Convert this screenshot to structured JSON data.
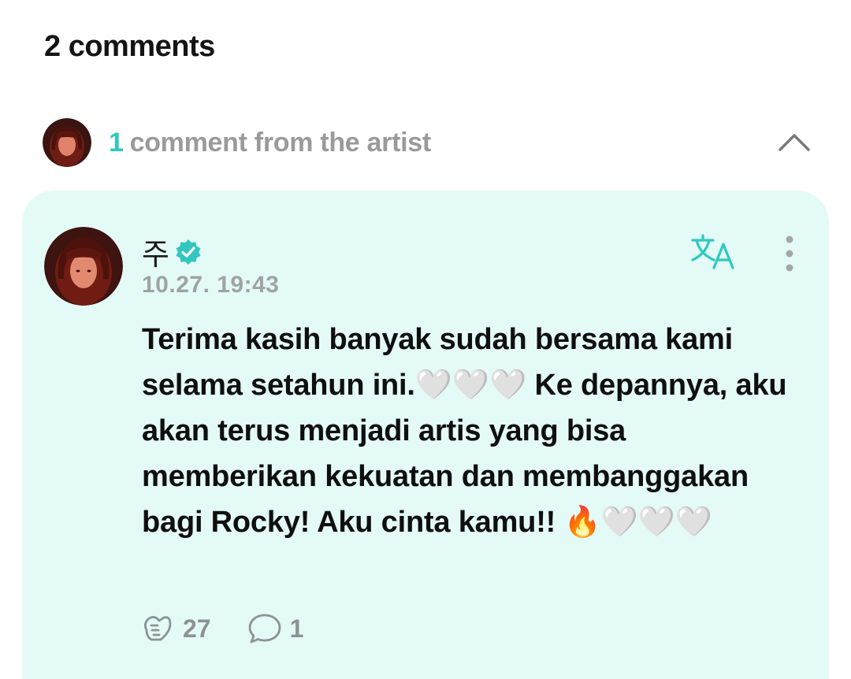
{
  "header": {
    "title": "2 comments"
  },
  "artist_section": {
    "count": "1",
    "label": "comment from the artist"
  },
  "comment": {
    "author": "주",
    "timestamp": "10.27. 19:43",
    "text": "Terima kasih banyak sudah bersama kami selama setahun ini.🤍🤍🤍 Ke depannya, aku akan terus menjadi artis yang bisa memberikan kekuatan dan membanggakan bagi Rocky! Aku cinta kamu!! 🔥🤍🤍🤍",
    "likes": "27",
    "replies": "1"
  },
  "colors": {
    "accent": "#2ec9c0",
    "card_background": "#e4faf6",
    "muted_text": "#9a9a9a"
  },
  "icons": {
    "verified": "verified-badge-icon",
    "translate": "translate-icon",
    "more": "more-vertical-icon",
    "collapse": "chevron-up-icon",
    "like": "like-icon",
    "reply": "comment-bubble-icon"
  }
}
